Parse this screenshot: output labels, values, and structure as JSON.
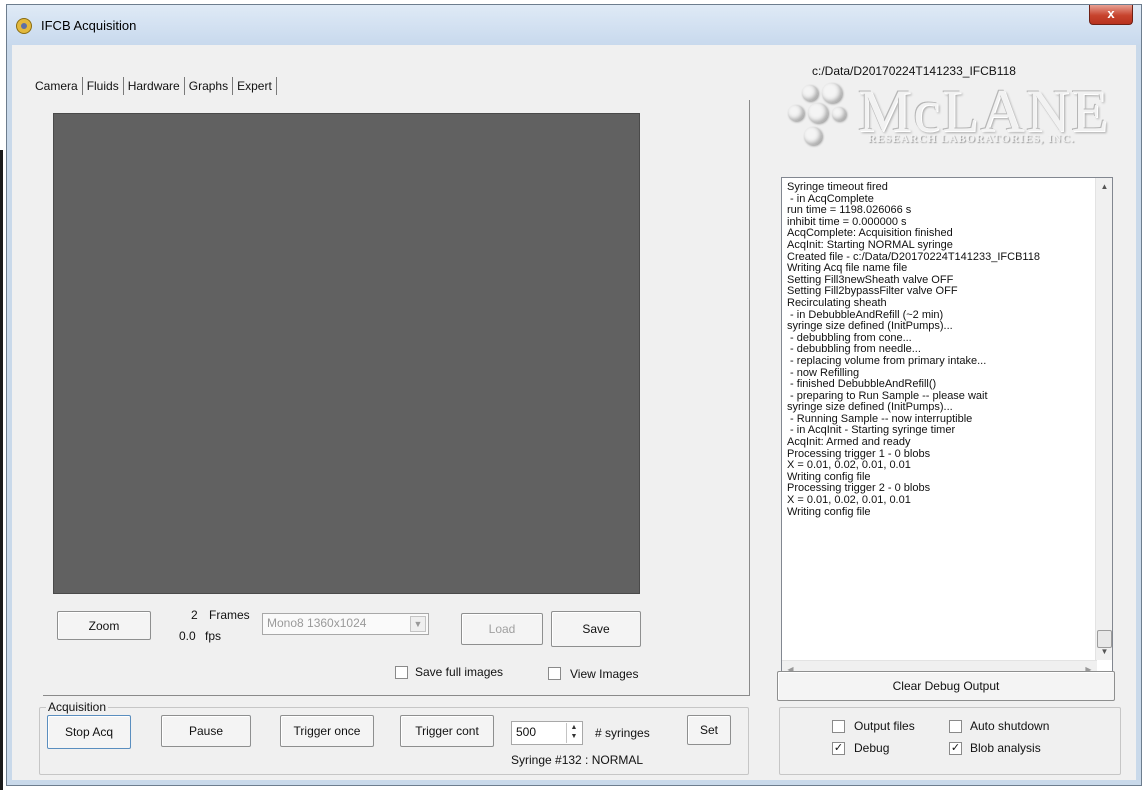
{
  "window": {
    "title": "IFCB Acquisition",
    "close_label": "x"
  },
  "tabs": [
    "Camera",
    "Fluids",
    "Hardware",
    "Graphs",
    "Expert"
  ],
  "camera": {
    "zoom_label": "Zoom",
    "frames_count": "2",
    "frames_label": "Frames",
    "fps_value": "0.0",
    "fps_label": "fps",
    "format_select_value": "Mono8 1360x1024",
    "load_label": "Load",
    "save_label": "Save",
    "save_full_images_label": "Save full images",
    "save_full_images_checked": false,
    "view_images_label": "View Images",
    "view_images_checked": false
  },
  "right_panel": {
    "data_path": "c:/Data/D20170224T141233_IFCB118",
    "logo_text": "McLANE",
    "logo_subtext": "RESEARCH LABORATORIES, INC.",
    "debug_lines": [
      "Syringe timeout fired",
      " - in AcqComplete",
      "run time = 1198.026066 s",
      "inhibit time = 0.000000 s",
      "AcqComplete: Acquisition finished",
      "AcqInit: Starting NORMAL syringe",
      "Created file - c:/Data/D20170224T141233_IFCB118",
      "Writing Acq file name file",
      "Setting Fill3newSheath valve OFF",
      "Setting Fill2bypassFilter valve OFF",
      "Recirculating sheath",
      " - in DebubbleAndRefill (~2 min)",
      "syringe size defined (InitPumps)...",
      " - debubbling from cone...",
      " - debubbling from needle...",
      " - replacing volume from primary intake...",
      " - now Refilling",
      " - finished DebubbleAndRefill()",
      " - preparing to Run Sample -- please wait",
      "syringe size defined (InitPumps)...",
      " - Running Sample -- now interruptible",
      " - in AcqInit - Starting syringe timer",
      "AcqInit: Armed and ready",
      "Processing trigger 1 - 0 blobs",
      "X = 0.01, 0.02, 0.01, 0.01",
      "Writing config file",
      "Processing trigger 2 - 0 blobs",
      "X = 0.01, 0.02, 0.01, 0.01",
      "Writing config file"
    ],
    "clear_debug_label": "Clear Debug Output"
  },
  "acquisition": {
    "group_label": "Acquisition",
    "stop_acq_label": "Stop Acq",
    "pause_label": "Pause",
    "trigger_once_label": "Trigger once",
    "trigger_cont_label": "Trigger cont",
    "syringes_value": "500",
    "syringes_label": "# syringes",
    "set_label": "Set",
    "syringe_status": "Syringe #132 : NORMAL"
  },
  "options": {
    "output_files_label": "Output files",
    "output_files_checked": false,
    "auto_shutdown_label": "Auto shutdown",
    "auto_shutdown_checked": false,
    "debug_label": "Debug",
    "debug_checked": true,
    "blob_analysis_label": "Blob analysis",
    "blob_analysis_checked": true
  },
  "colors": {
    "window_bg": "#f0f0f0",
    "camera_bg": "#616161",
    "titlebar": "#c8d9ed",
    "close_button": "#c7432d"
  }
}
